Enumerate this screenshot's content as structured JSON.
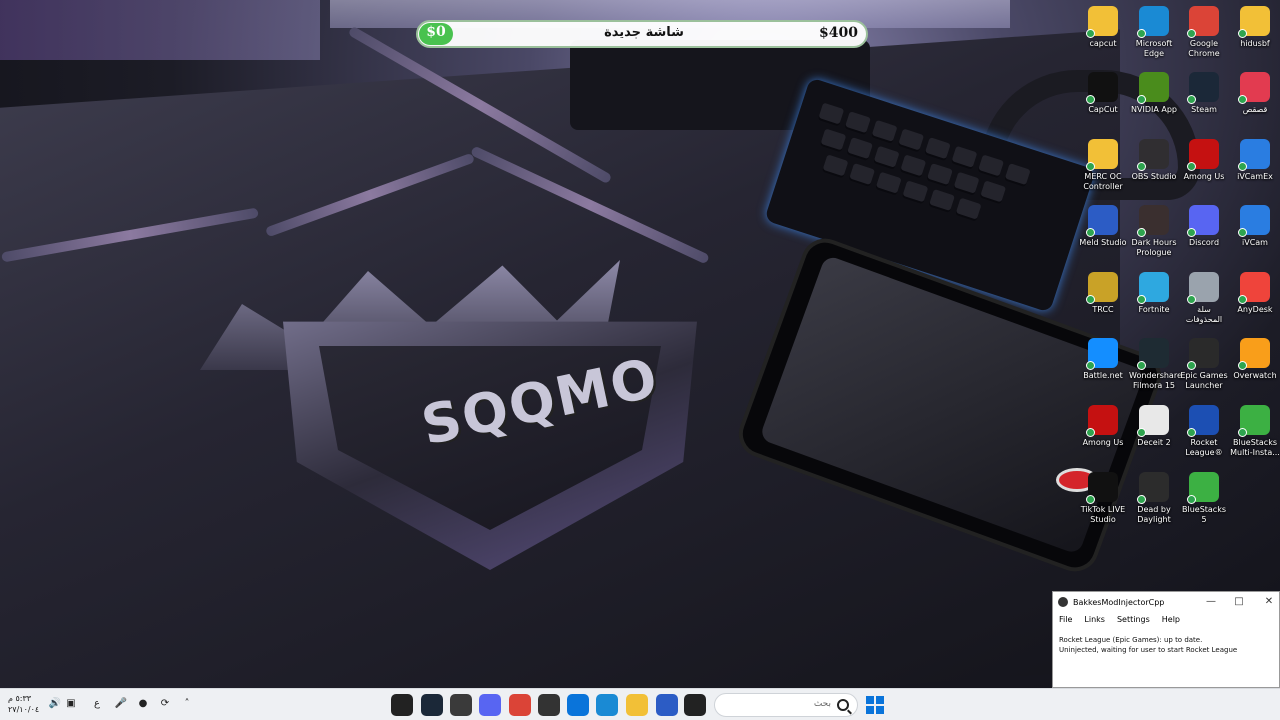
{
  "recording_bar": {
    "left_amount": "$0",
    "title": "شاشة جديدة",
    "right_amount": "$400"
  },
  "wallpaper": {
    "logo_text": "SQQMO"
  },
  "desktop_icons": [
    {
      "label": "capcut",
      "icon": "folder-icon",
      "color": "#f2c037"
    },
    {
      "label": "Microsoft Edge",
      "icon": "edge-icon",
      "color": "#1a8ad4"
    },
    {
      "label": "Google Chrome",
      "icon": "chrome-icon",
      "color": "#db4437"
    },
    {
      "label": "hidusbf",
      "icon": "folder-icon",
      "color": "#f2c037"
    },
    {
      "label": "CapCut",
      "icon": "capcut-icon",
      "color": "#111111"
    },
    {
      "label": "NVIDIA App",
      "icon": "nvidia-icon",
      "color": "#4a8c1c"
    },
    {
      "label": "Steam",
      "icon": "steam-icon",
      "color": "#1b2838"
    },
    {
      "label": "قصقص",
      "icon": "app-icon",
      "color": "#e23b50"
    },
    {
      "label": "MERC OC Controller",
      "icon": "folder-icon",
      "color": "#f2c037"
    },
    {
      "label": "OBS Studio",
      "icon": "obs-icon",
      "color": "#302e31"
    },
    {
      "label": "Among Us",
      "icon": "among-us-icon",
      "color": "#c51111"
    },
    {
      "label": "iVCamEx",
      "icon": "ivcam-icon",
      "color": "#2a7de1"
    },
    {
      "label": "Meld Studio",
      "icon": "meld-icon",
      "color": "#2c5cc5"
    },
    {
      "label": "Dark Hours Prologue",
      "icon": "dark-hours-icon",
      "color": "#3a2f2f"
    },
    {
      "label": "Discord",
      "icon": "discord-icon",
      "color": "#5865f2"
    },
    {
      "label": "iVCam",
      "icon": "ivcam-icon",
      "color": "#2a7de1"
    },
    {
      "label": "TRCC",
      "icon": "trcc-icon",
      "color": "#c9a227"
    },
    {
      "label": "Fortnite",
      "icon": "fortnite-icon",
      "color": "#2ea8e0"
    },
    {
      "label": "سلة المحذوفات",
      "icon": "recycle-bin-icon",
      "color": "#9aa3ad"
    },
    {
      "label": "AnyDesk",
      "icon": "anydesk-icon",
      "color": "#ef443b"
    },
    {
      "label": "Battle.net",
      "icon": "battlenet-icon",
      "color": "#148eff"
    },
    {
      "label": "Wondershare Filmora 15",
      "icon": "filmora-icon",
      "color": "#1e2b33"
    },
    {
      "label": "Epic Games Launcher",
      "icon": "epic-games-icon",
      "color": "#2a2a2a"
    },
    {
      "label": "Overwatch",
      "icon": "overwatch-icon",
      "color": "#f99e1a"
    },
    {
      "label": "Among Us",
      "icon": "among-us-icon",
      "color": "#c51111"
    },
    {
      "label": "Deceit 2",
      "icon": "deceit-icon",
      "color": "#e8e8e8"
    },
    {
      "label": "Rocket League®",
      "icon": "rocket-league-icon",
      "color": "#1c4fb3"
    },
    {
      "label": "BlueStacks Multi-Insta...",
      "icon": "bluestacks-icon",
      "color": "#3cb043"
    },
    {
      "label": "TikTok LIVE Studio",
      "icon": "tiktok-icon",
      "color": "#111111"
    },
    {
      "label": "Dead by Daylight",
      "icon": "dead-by-daylight-icon",
      "color": "#2c2c2c"
    },
    {
      "label": "BlueStacks 5",
      "icon": "bluestacks-icon",
      "color": "#3cb043"
    }
  ],
  "bakkes_window": {
    "title": "BakkesModInjectorCpp",
    "menu": [
      "File",
      "Links",
      "Settings",
      "Help"
    ],
    "status_line1": "Rocket League (Epic Games): up to date.",
    "status_line2": "Uninjected, waiting for user to start Rocket League"
  },
  "taskbar": {
    "clock_time": "٥:٣٣ م",
    "clock_date": "٢٧/١٠/٠٤",
    "lang": "ع",
    "search_placeholder": "بحث",
    "apps": [
      {
        "name": "red-dot-app-icon",
        "color": "#222222"
      },
      {
        "name": "steam-icon",
        "color": "#1b2838"
      },
      {
        "name": "app-icon",
        "color": "#3a3a3a"
      },
      {
        "name": "discord-icon",
        "color": "#5865f2"
      },
      {
        "name": "chrome-icon",
        "color": "#db4437"
      },
      {
        "name": "cube-icon",
        "color": "#333333"
      },
      {
        "name": "store-icon",
        "color": "#0a74da"
      },
      {
        "name": "edge-icon",
        "color": "#1a8ad4"
      },
      {
        "name": "file-explorer-icon",
        "color": "#f2c037"
      },
      {
        "name": "meld-icon",
        "color": "#2c5cc5"
      },
      {
        "name": "window-icon",
        "color": "#222222"
      }
    ]
  }
}
